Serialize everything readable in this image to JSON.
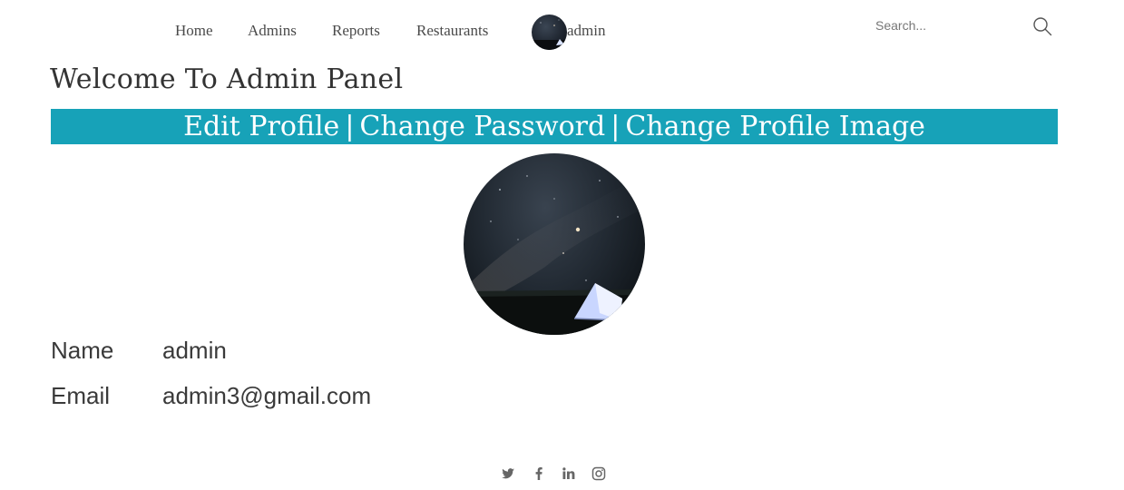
{
  "nav": {
    "links": [
      "Home",
      "Admins",
      "Reports",
      "Restaurants"
    ],
    "user_label": "admin",
    "search_placeholder": "Search..."
  },
  "page": {
    "title": "Welcome To Admin Panel",
    "actions": [
      "Edit Profile",
      "Change Password",
      "Change Profile Image"
    ],
    "separator": "|"
  },
  "profile": {
    "fields": [
      {
        "label": "Name",
        "value": "admin"
      },
      {
        "label": "Email",
        "value": "admin3@gmail.com"
      }
    ]
  },
  "footer": {
    "social_icons": [
      "twitter-icon",
      "facebook-icon",
      "linkedin-icon",
      "instagram-icon"
    ]
  },
  "colors": {
    "accent_bar": "#17a2b8",
    "text": "#333333",
    "nav_text": "#4a4a4a"
  }
}
